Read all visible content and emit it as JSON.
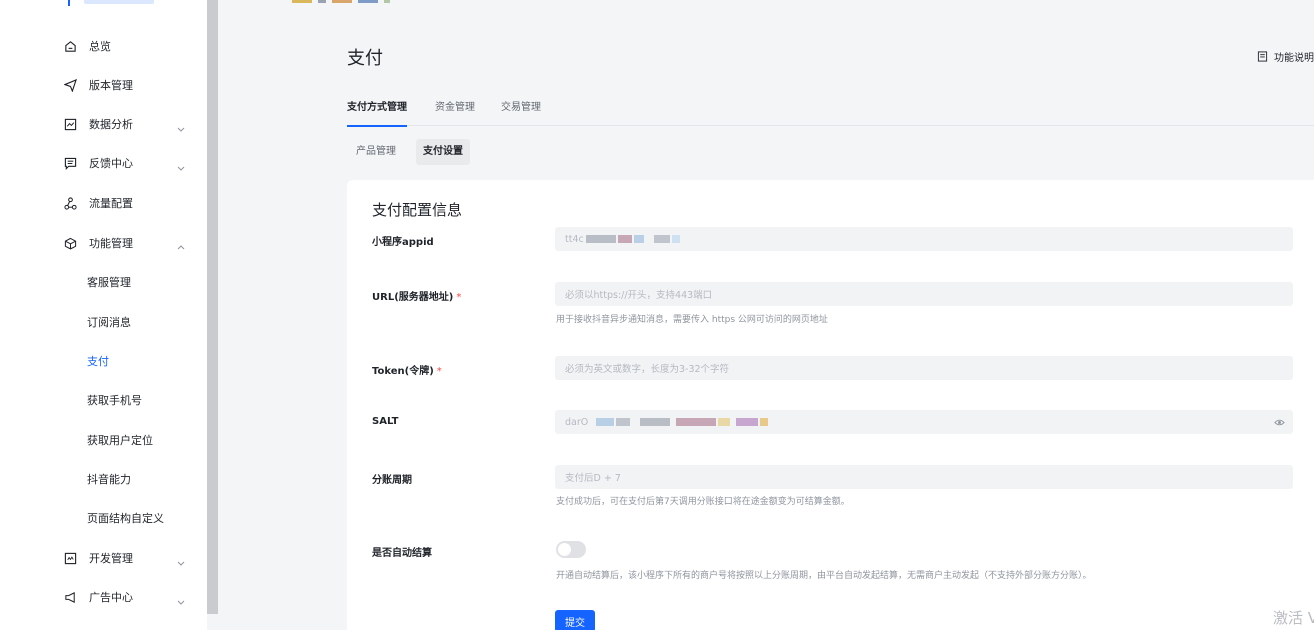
{
  "sidebar": {
    "items": [
      {
        "label": "总览",
        "icon": "home-icon"
      },
      {
        "label": "版本管理",
        "icon": "send-icon"
      },
      {
        "label": "数据分析",
        "icon": "chart-icon"
      },
      {
        "label": "反馈中心",
        "icon": "message-icon"
      },
      {
        "label": "流量配置",
        "icon": "share-icon"
      },
      {
        "label": "功能管理",
        "icon": "cube-icon"
      },
      {
        "label": "开发管理",
        "icon": "code-icon"
      },
      {
        "label": "广告中心",
        "icon": "megaphone-icon"
      }
    ],
    "sub_items": [
      {
        "label": "客服管理"
      },
      {
        "label": "订阅消息"
      },
      {
        "label": "支付"
      },
      {
        "label": "获取手机号"
      },
      {
        "label": "获取用户定位"
      },
      {
        "label": "抖音能力"
      },
      {
        "label": "页面结构自定义"
      }
    ]
  },
  "header": {
    "title": "支付",
    "help_label": "功能说明"
  },
  "tabs": [
    {
      "label": "支付方式管理"
    },
    {
      "label": "资金管理"
    },
    {
      "label": "交易管理"
    }
  ],
  "subtabs": [
    {
      "label": "产品管理"
    },
    {
      "label": "支付设置"
    }
  ],
  "form": {
    "title": "支付配置信息",
    "appid": {
      "label": "小程序appid",
      "value": "tt4c"
    },
    "url": {
      "label": "URL(服务器地址)",
      "placeholder": "必须以https://开头，支持443端口",
      "help": "用于接收抖音异步通知消息，需要传入 https 公网可访问的网页地址"
    },
    "token": {
      "label": "Token(令牌)",
      "placeholder": "必须为英文或数字，长度为3-32个字符"
    },
    "salt": {
      "label": "SALT",
      "value": "darO"
    },
    "period": {
      "label": "分账周期",
      "value": "支付后D + 7",
      "help": "支付成功后，可在支付后第7天调用分账接口将在途金额变为可结算金额。"
    },
    "auto": {
      "label": "是否自动结算",
      "help": "开通自动结算后，该小程序下所有的商户号将按照以上分账周期，由平台自动发起结算，无需商户主动发起（不支持外部分账方分账）。"
    },
    "required_mark": "*",
    "submit_label": "提交"
  },
  "watermark": "激活 V",
  "colors": {
    "accent": "#1664ff",
    "required": "#f54a45"
  }
}
